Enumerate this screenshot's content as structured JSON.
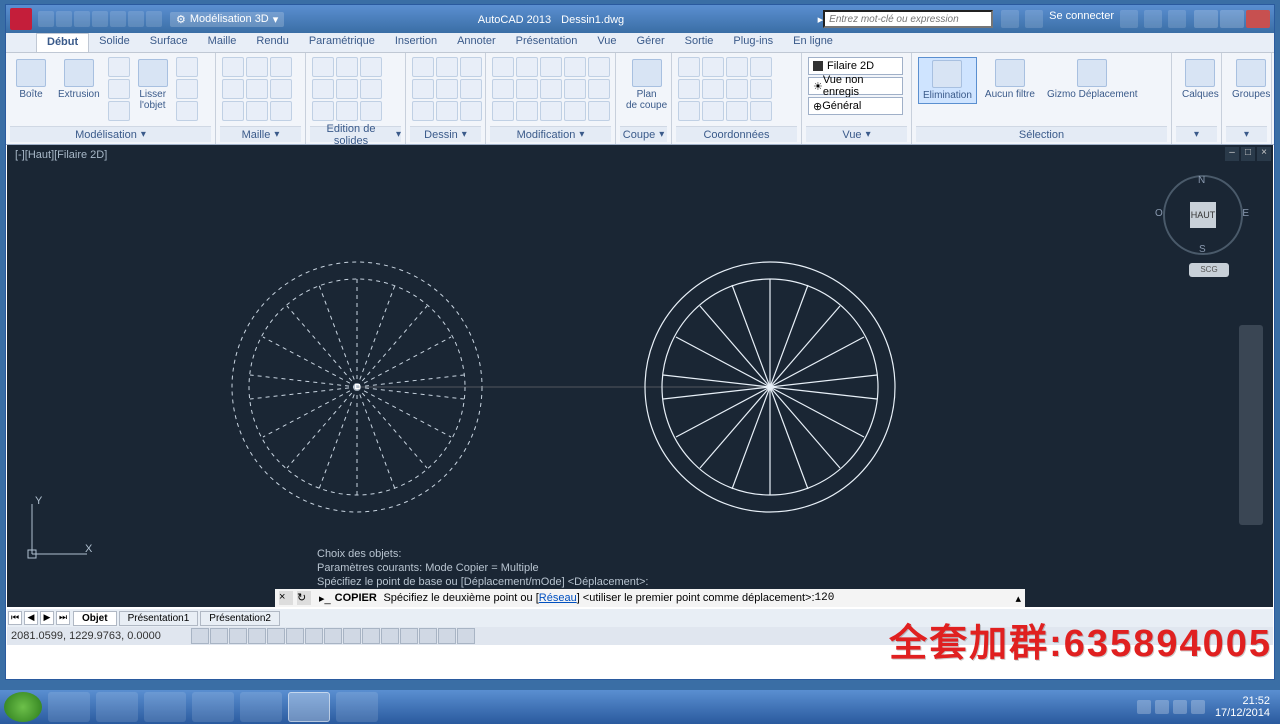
{
  "title": {
    "app": "AutoCAD 2013",
    "file": "Dessin1.dwg"
  },
  "workspace": "Modélisation 3D",
  "search_placeholder": "Entrez mot-clé ou expression",
  "signin": "Se connecter",
  "tabs": [
    "Début",
    "Solide",
    "Surface",
    "Maille",
    "Rendu",
    "Paramétrique",
    "Insertion",
    "Annoter",
    "Présentation",
    "Vue",
    "Gérer",
    "Sortie",
    "Plug-ins",
    "En ligne"
  ],
  "panels": {
    "modeling": {
      "boite": "Boîte",
      "extrusion": "Extrusion",
      "lisser": "Lisser\nl'objet",
      "title": "Modélisation"
    },
    "maille": "Maille",
    "edit_solides": "Edition de solides",
    "dessin": "Dessin",
    "modification": "Modification",
    "plan_coupe": "Plan\nde coupe",
    "coupe": "Coupe",
    "layer_filaire": "Filaire 2D",
    "layer_vue": "Vue non enregis",
    "layer_general": "Général",
    "coordonnees": "Coordonnées",
    "vue": "Vue",
    "elimination": "Elimination",
    "aucun_filtre": "Aucun filtre",
    "gizmo": "Gizmo Déplacement",
    "selection": "Sélection",
    "calques": "Calques",
    "groupes": "Groupes"
  },
  "viewport_label": "[-][Haut][Filaire 2D]",
  "viewcube": {
    "face": "HAUT",
    "n": "N",
    "s": "S",
    "e": "E",
    "o": "O",
    "scg": "SCG"
  },
  "cmd_history": [
    "Choix des objets:",
    "Paramètres courants:  Mode Copier = Multiple",
    "Spécifiez le point de base ou [Déplacement/mOde] <Déplacement>:"
  ],
  "cmd_line": {
    "cmd": "COPIER",
    "prompt": "Spécifiez le deuxième point ou [",
    "option": "Réseau",
    "prompt2": "] <utiliser le premier point comme déplacement>: ",
    "value": "120"
  },
  "model_tabs": [
    "Objet",
    "Présentation1",
    "Présentation2"
  ],
  "coords": "2081.0599, 1229.9763, 0.0000",
  "watermark": "全套加群:635894005",
  "clock": {
    "time": "21:52",
    "date": "17/12/2014"
  }
}
